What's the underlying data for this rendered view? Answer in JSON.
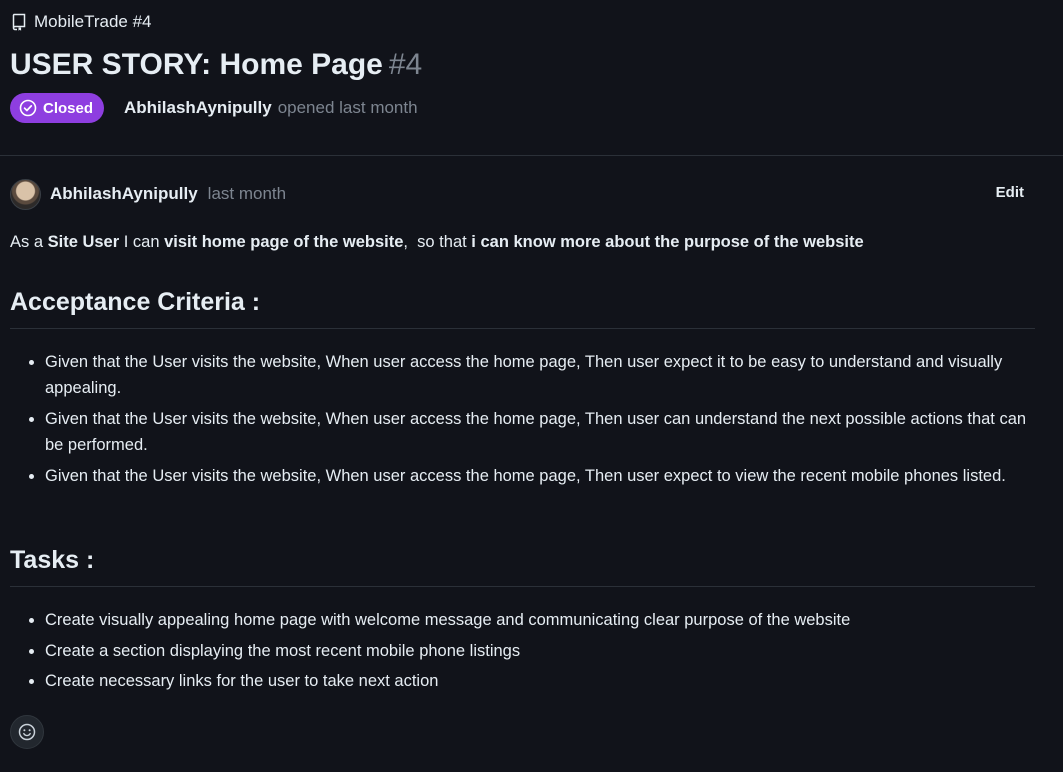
{
  "repo": {
    "label": "MobileTrade #4",
    "icon": "repo-icon"
  },
  "issue": {
    "title": "USER STORY: Home Page",
    "number": "#4",
    "status": "Closed",
    "status_icon": "check-circle-icon",
    "status_color": "#8e3ee0",
    "author": "AbhilashAynipully",
    "opened_text": "opened last month"
  },
  "comment": {
    "author": "AbhilashAynipully",
    "time": "last month",
    "edit_label": "Edit",
    "story": {
      "p1": "As a ",
      "b1": "Site User",
      "p2": " I can ",
      "b2": "visit home page of the website",
      "p3": ",  so that ",
      "b3": "i can know more about the purpose of the website"
    },
    "acceptance_heading": "Acceptance Criteria :",
    "criteria": [
      "Given that the User visits the website, When user access the home page, Then user expect it to be easy to understand and visually appealing.",
      "Given that the User visits the website, When user access the home page, Then user can understand the next possible actions that can be performed.",
      "Given that the User visits the website, When user access the home page, Then user expect to view the recent mobile phones listed."
    ],
    "tasks_heading": "Tasks :",
    "tasks": [
      "Create visually appealing home page with welcome message and communicating clear purpose of the website",
      "Create a section displaying the most recent mobile phone listings",
      "Create necessary links for the user to take next action"
    ],
    "reaction_icon": "smiley-icon"
  }
}
